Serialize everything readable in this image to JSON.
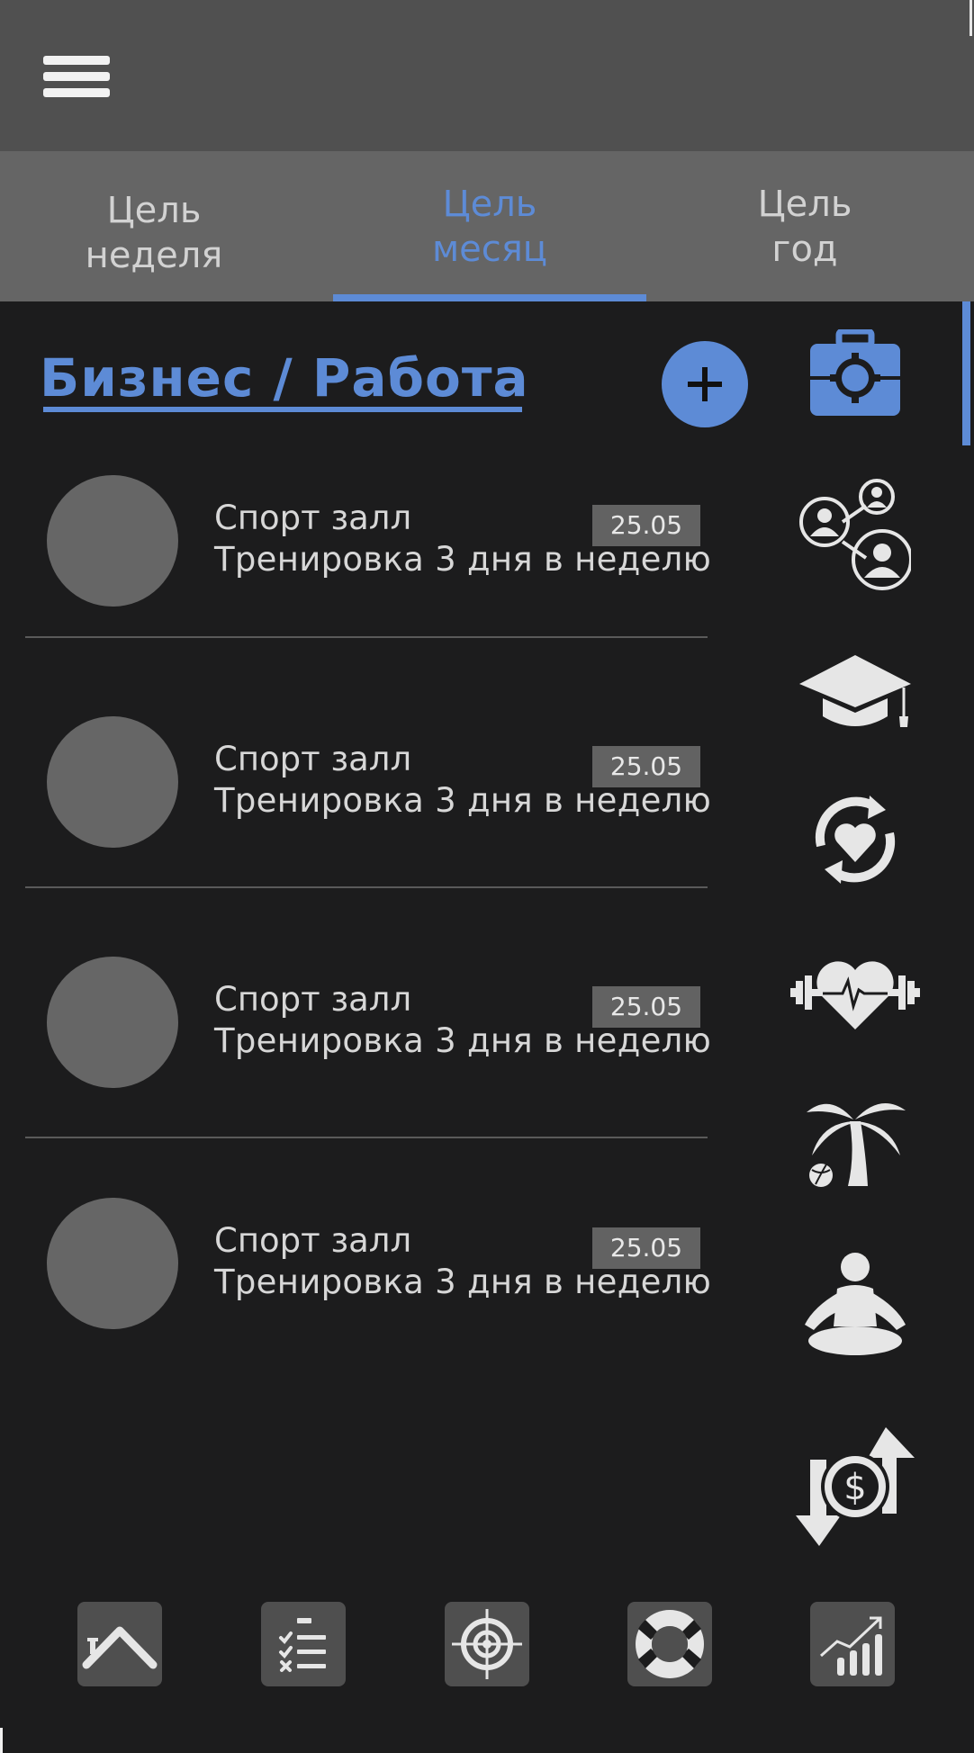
{
  "header": {
    "menu_icon": "hamburger-menu-icon"
  },
  "tabs": [
    {
      "line1": "Цель",
      "line2": "неделя",
      "active": false
    },
    {
      "line1": "Цель",
      "line2": "месяц",
      "active": true
    },
    {
      "line1": "Цель",
      "line2": "год",
      "active": false
    }
  ],
  "section": {
    "title": "Бизнес / Работа",
    "add_icon": "plus-icon"
  },
  "goals": [
    {
      "title": "Спорт залл",
      "subtitle": "Тренировка 3 дня в неделю",
      "date": "25.05"
    },
    {
      "title": "Спорт залл",
      "subtitle": "Тренировка 3 дня в неделю",
      "date": "25.05"
    },
    {
      "title": "Спорт залл",
      "subtitle": "Тренировка 3 дня в неделю",
      "date": "25.05"
    },
    {
      "title": "Спорт залл",
      "subtitle": "Тренировка 3 дня в неделю",
      "date": "25.05"
    }
  ],
  "categories": [
    "briefcase-gear-icon",
    "people-network-icon",
    "graduation-cap-icon",
    "heart-cycle-icon",
    "heart-dumbbell-icon",
    "palm-tree-ball-icon",
    "meditation-icon",
    "money-exchange-icon"
  ],
  "bottom_nav": [
    "home-icon",
    "checklist-icon",
    "target-icon",
    "lifebuoy-icon",
    "growth-chart-icon"
  ],
  "colors": {
    "accent": "#5d8bd6",
    "background": "#1c1c1d",
    "header": "#505050",
    "tabs": "#656565",
    "icon_light": "#e6e6e6"
  }
}
